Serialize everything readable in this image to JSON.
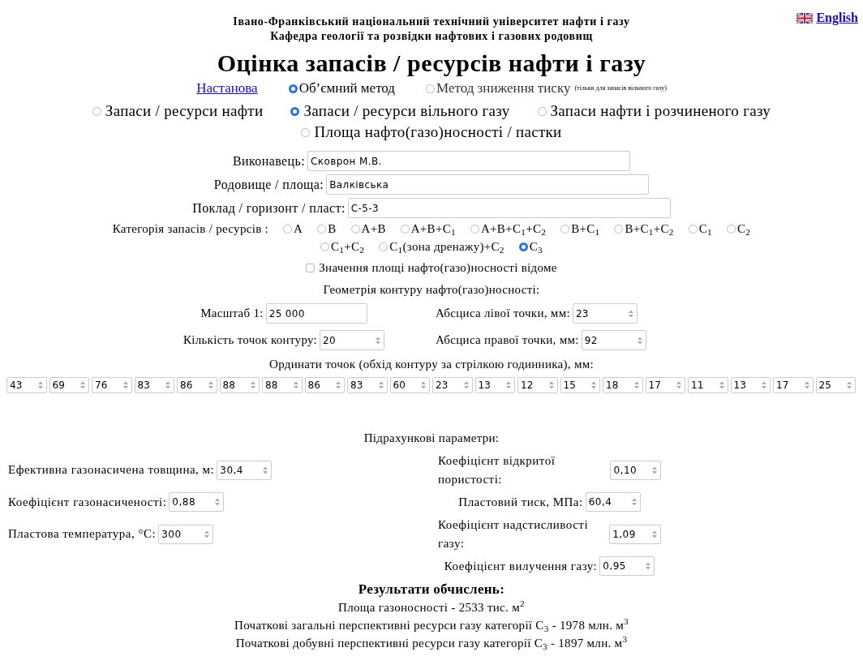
{
  "header": {
    "university": "Івано-Франківський національний технічний університет нафти і газу",
    "department": "Кафедра геології та розвідки нафтових і газових родовищ",
    "language_link": "English"
  },
  "title": "Оцінка запасів / ресурсів нафти і газу",
  "mode": {
    "help_link": "Настанова",
    "methods": [
      {
        "label": "Об’ємний метод",
        "selected": true
      },
      {
        "label": "Метод зниження тиску",
        "note": "(тільки для запасів вільного газу)",
        "selected": false
      }
    ]
  },
  "targets": [
    {
      "label": "Запаси / ресурси нафти",
      "selected": false
    },
    {
      "label": "Запаси / ресурси вільного газу",
      "selected": true
    },
    {
      "label": "Запаси нафти і розчиненого газу",
      "selected": false
    },
    {
      "label": "Площа нафто(газо)носності / пастки",
      "selected": false
    }
  ],
  "fields": [
    {
      "label": "Виконавець:",
      "value": "Сковрон М.В."
    },
    {
      "label": "Родовище / площа:",
      "value": "Валківська"
    },
    {
      "label": "Поклад / горизонт / пласт:",
      "value": "С-5-3"
    }
  ],
  "category": {
    "label": "Категорія запасів / ресурсів :",
    "options": [
      {
        "label": "A",
        "selected": false
      },
      {
        "label": "B",
        "selected": false
      },
      {
        "label": "A+B",
        "selected": false
      },
      {
        "label": "A+B+C$_{1}$",
        "selected": false
      },
      {
        "label": "A+B+C$_{1}$+C$_{2}$",
        "selected": false
      },
      {
        "label": "B+C$_{1}$",
        "selected": false
      },
      {
        "label": "B+C$_{1}$+C$_{2}$",
        "selected": false
      },
      {
        "label": "C$_{1}$",
        "selected": false
      },
      {
        "label": "C$_{2}$",
        "selected": false
      },
      {
        "label": "C$_{1}$+C$_{2}$",
        "selected": false
      },
      {
        "label": "C$_{1}$(зона дренажу)+C$_{2}$",
        "selected": false
      },
      {
        "label": "C$_{3}$",
        "selected": true
      }
    ]
  },
  "area_known": {
    "label": "Значення площі нафто(газо)носності відоме",
    "checked": false
  },
  "geometry": {
    "heading": "Геометрія контуру нафто(газо)носності:",
    "left": [
      {
        "label": "Масштаб 1:",
        "value": "25 000",
        "kind": "text"
      },
      {
        "label": "Кількість точок контуру:",
        "value": "20",
        "kind": "number"
      }
    ],
    "right": [
      {
        "label": "Абсциса лівої точки, мм:",
        "value": "23",
        "kind": "number"
      },
      {
        "label": "Абсциса правої точки, мм:",
        "value": "92",
        "kind": "number"
      }
    ],
    "ordinates_heading": "Ординати точок (обхід контуру за стрілкою годинника), мм:",
    "ordinates": [
      "43",
      "69",
      "76",
      "83",
      "86",
      "88",
      "88",
      "86",
      "83",
      "60",
      "23",
      "13",
      "12",
      "15",
      "18",
      "17",
      "11",
      "13",
      "17",
      "25"
    ]
  },
  "parameters": {
    "heading": "Підрахункові параметри:",
    "left": [
      {
        "label": "Ефективна газонасичена товщина, м:",
        "value": "30,4",
        "kind": "number"
      },
      {
        "label": "Коефіцієнт газонасиченості:",
        "value": "0,88",
        "kind": "number"
      },
      {
        "label": "Пластова температура, °C:",
        "value": "300",
        "kind": "number"
      }
    ],
    "right": [
      {
        "label": "Коефіцієнт відкритої пористості:",
        "value": "0,10",
        "kind": "number"
      },
      {
        "label": "Пластовий тиск, МПа:",
        "value": "60,4",
        "kind": "number"
      },
      {
        "label": "Коефіцієнт надстисливості газу:",
        "value": "1,09",
        "kind": "number"
      },
      {
        "label": "Коефіцієнт вилучення газу:",
        "value": "0,95",
        "kind": "number"
      }
    ]
  },
  "results": {
    "heading": "Результати обчислень:",
    "lines": [
      "Площа газоносності - 2533 тис. м$^{2}$",
      "Початкові загальні перспективні ресурси газу категорії C$_{3}$ - 1978 млн. м$^{3}$",
      "Початкові добувні перспективні ресурси газу категорії C$_{3}$ - 1897 млн. м$^{3}$"
    ]
  }
}
